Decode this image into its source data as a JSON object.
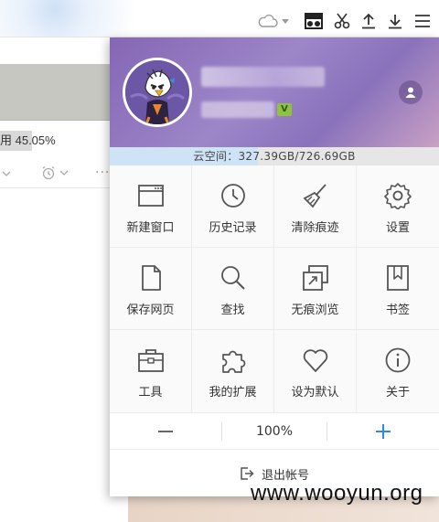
{
  "background": {
    "progress_text": "用 45.05%",
    "progress_fraction": 0.27,
    "controls_more": "···",
    "toolbar_icons": [
      "cloud-icon",
      "reader-mode-icon",
      "scissors-icon",
      "upload-icon",
      "download-icon",
      "menu-icon"
    ]
  },
  "account": {
    "avatar_icon": "eagle-avatar-icon",
    "vip_badge": "V",
    "user_icon": "user-icon"
  },
  "storage": {
    "label": "云空间：327.39GB/726.69GB",
    "used_fraction": 0.45
  },
  "menu_items": [
    {
      "label": "新建窗口",
      "icon": "new-window-icon"
    },
    {
      "label": "历史记录",
      "icon": "history-clock-icon"
    },
    {
      "label": "清除痕迹",
      "icon": "broom-icon"
    },
    {
      "label": "设置",
      "icon": "gear-icon"
    },
    {
      "label": "保存网页",
      "icon": "save-page-icon"
    },
    {
      "label": "查找",
      "icon": "search-icon"
    },
    {
      "label": "无痕浏览",
      "icon": "incognito-window-icon"
    },
    {
      "label": "书签",
      "icon": "bookmark-icon"
    },
    {
      "label": "工具",
      "icon": "toolbox-icon"
    },
    {
      "label": "我的扩展",
      "icon": "puzzle-icon"
    },
    {
      "label": "设为默认",
      "icon": "heart-icon"
    },
    {
      "label": "关于",
      "icon": "info-icon"
    }
  ],
  "zoom": {
    "minus_symbol": "−",
    "level": "100%",
    "plus_symbol": "+",
    "colors": {
      "plus": "#2b8be6"
    }
  },
  "logout": {
    "label": "退出帐号",
    "icon": "logout-icon"
  },
  "watermark": "www.wooyun.org",
  "colors": {
    "header_gradient_start": "#8566b5",
    "storage_fill": "#cfe3f6",
    "accent_blue": "#2b8be6"
  }
}
